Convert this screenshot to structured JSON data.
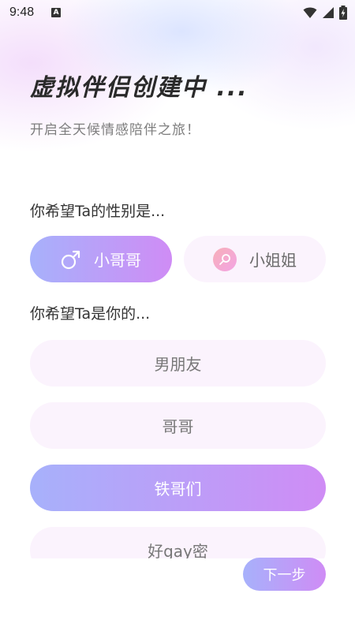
{
  "status_bar": {
    "time": "9:48",
    "notification_badge": "A",
    "icons": [
      "wifi-icon",
      "signal-icon",
      "battery-charging-icon"
    ]
  },
  "header": {
    "title": "虚拟伴侣创建中 ...",
    "subtitle": "开启全天候情感陪伴之旅！"
  },
  "gender_question": {
    "label": "你希望Ta的性别是...",
    "options": [
      {
        "label": "小哥哥",
        "icon": "male-symbol-icon",
        "selected": true
      },
      {
        "label": "小姐姐",
        "icon": "female-symbol-icon",
        "selected": false
      }
    ]
  },
  "relationship_question": {
    "label": "你希望Ta是你的...",
    "options": [
      {
        "label": "男朋友",
        "selected": false
      },
      {
        "label": "哥哥",
        "selected": false
      },
      {
        "label": "铁哥们",
        "selected": true
      },
      {
        "label": "好gay密",
        "selected": false
      }
    ]
  },
  "footer": {
    "next_label": "下一步"
  },
  "colors": {
    "accent_gradient_start": "#a7b1fb",
    "accent_gradient_end": "#cf8cf5",
    "unselected_bg": "#fbf3fd"
  }
}
